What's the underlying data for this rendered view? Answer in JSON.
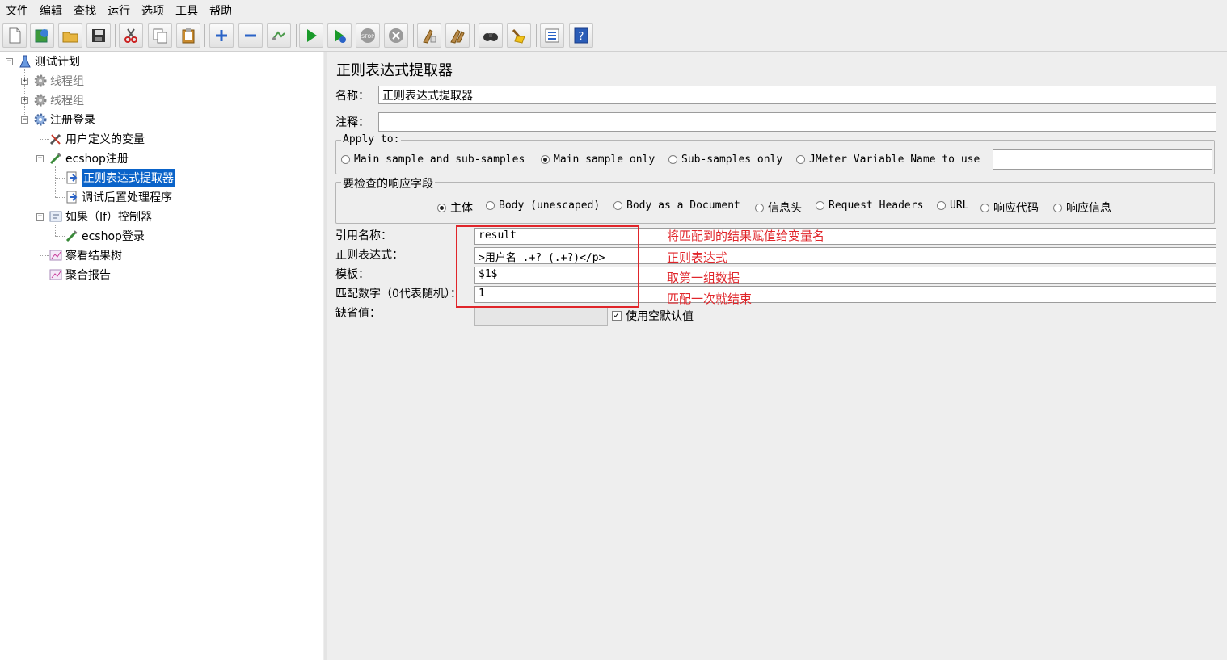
{
  "menu": [
    "文件",
    "编辑",
    "查找",
    "运行",
    "选项",
    "工具",
    "帮助"
  ],
  "toolbar": {
    "buttons": [
      {
        "name": "new-icon"
      },
      {
        "name": "templates-icon"
      },
      {
        "name": "open-icon"
      },
      {
        "name": "save-icon"
      },
      {
        "name": "cut-icon"
      },
      {
        "name": "copy-icon"
      },
      {
        "name": "paste-icon"
      },
      {
        "name": "expand-icon"
      },
      {
        "name": "collapse-icon"
      },
      {
        "name": "toggle-icon"
      },
      {
        "name": "start-icon"
      },
      {
        "name": "start-no-pause-icon"
      },
      {
        "name": "stop-icon"
      },
      {
        "name": "shutdown-icon"
      },
      {
        "name": "clear-icon"
      },
      {
        "name": "clear-all-icon"
      },
      {
        "name": "search-icon"
      },
      {
        "name": "reset-search-icon"
      },
      {
        "name": "function-helper-icon"
      },
      {
        "name": "help-icon"
      }
    ]
  },
  "tree": {
    "items": [
      {
        "label": "测试计划",
        "icon": "test-plan-icon"
      },
      {
        "label": "线程组",
        "icon": "thread-group-icon"
      },
      {
        "label": "线程组",
        "icon": "thread-group-icon"
      },
      {
        "label": "注册登录",
        "icon": "thread-group-icon"
      },
      {
        "label": "用户定义的变量",
        "icon": "config-element-icon"
      },
      {
        "label": "ecshop注册",
        "icon": "sampler-icon"
      },
      {
        "label": "正则表达式提取器",
        "icon": "post-processor-icon"
      },
      {
        "label": "调试后置处理程序",
        "icon": "post-processor-icon"
      },
      {
        "label": "如果（If）控制器",
        "icon": "controller-icon"
      },
      {
        "label": "ecshop登录",
        "icon": "sampler-icon"
      },
      {
        "label": "察看结果树",
        "icon": "listener-icon"
      },
      {
        "label": "聚合报告",
        "icon": "listener-icon"
      }
    ]
  },
  "panel": {
    "title": "正则表达式提取器",
    "name_label": "名称：",
    "name_value": "正则表达式提取器",
    "comment_label": "注释：",
    "comment_value": "",
    "apply_to": {
      "legend": "Apply to:",
      "options": [
        "Main sample and sub-samples",
        "Main sample only",
        "Sub-samples only",
        "JMeter Variable Name to use"
      ],
      "selected": "Main sample only",
      "variable_value": ""
    },
    "response_field": {
      "legend": "要检查的响应字段",
      "options": [
        "主体",
        "Body (unescaped)",
        "Body as a Document",
        "信息头",
        "Request Headers",
        "URL",
        "响应代码",
        "响应信息"
      ],
      "selected": "主体"
    },
    "ref_name_label": "引用名称：",
    "ref_name_value": "result",
    "regex_label": "正则表达式：",
    "regex_value": ">用户名 .+? (.+?)</p>",
    "template_label": "模板：",
    "template_value": "$1$",
    "match_no_label": "匹配数字（0代表随机）：",
    "match_no_value": "1",
    "default_label": "缺省值：",
    "default_value": "",
    "use_empty_default_label": "使用空默认值",
    "use_empty_default_checked": true
  },
  "annotations": {
    "color": "#e0252a",
    "ref_name_note": "将匹配到的结果赋值给变量名",
    "regex_note": "正则表达式",
    "template_note": "取第一组数据",
    "match_no_note": "匹配一次就结束"
  }
}
